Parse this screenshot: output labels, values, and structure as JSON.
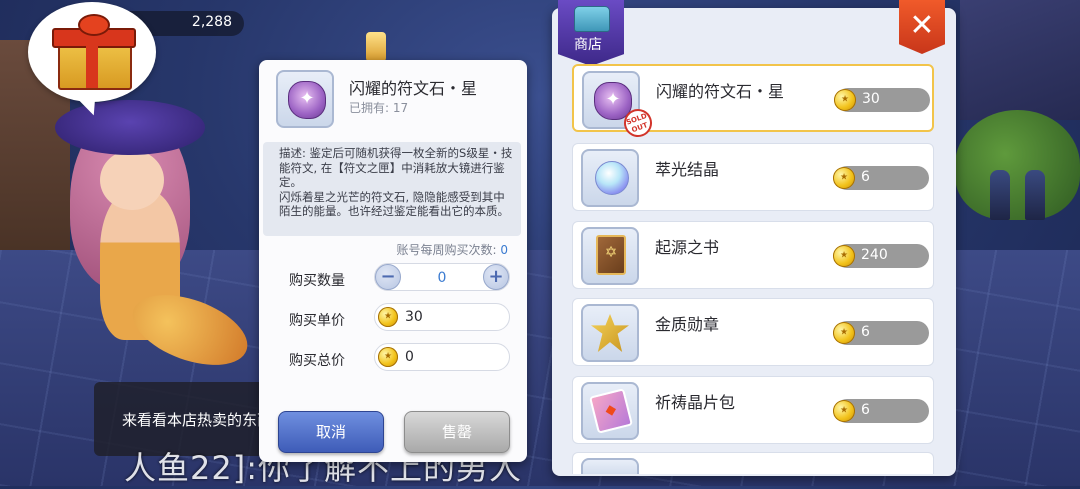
{
  "hud": {
    "coins": "2,288"
  },
  "chat": {
    "message": "来看看本店热卖的东西",
    "caption": "人鱼22]:你了解不上的男人"
  },
  "detail": {
    "item_name": "闪耀的符文石・星",
    "owned": "已拥有: 17",
    "description_1": "描述: 鉴定后可随机获得一枚全新的S级星・技能符文, 在【符文之匣】中消耗放大镜进行鉴定。",
    "description_2": "闪烁着星之光芒的符文石, 隐隐能感受到其中陌生的能量。也许经过鉴定能看出它的本质。",
    "weekly_label": "账号每周购买次数:",
    "weekly_count": "0",
    "qty_label": "购买数量",
    "qty_value": "0",
    "qty_minus": "−",
    "qty_plus": "+",
    "unit_label": "购买单价",
    "unit_price": "30",
    "total_label": "购买总价",
    "total_price": "0",
    "cancel_label": "取消",
    "sell_label": "售罄"
  },
  "shop": {
    "tab_label": "商店",
    "close_label": "✕",
    "sold_out_stamp": "SOLD OUT",
    "items": [
      {
        "name": "闪耀的符文石・星",
        "price": "30",
        "icon": "rune-stone-icon"
      },
      {
        "name": "萃光结晶",
        "price": "6",
        "icon": "crystal-icon"
      },
      {
        "name": "起源之书",
        "price": "240",
        "icon": "book-icon"
      },
      {
        "name": "金质勋章",
        "price": "6",
        "icon": "medal-icon"
      },
      {
        "name": "祈祷晶片包",
        "price": "6",
        "icon": "card-pack-icon"
      }
    ]
  },
  "colors": {
    "confirm_blue": "#3e5cb8",
    "disabled_gray": "#a9a9a9",
    "highlight_gold": "#f2c44a",
    "close_red": "#d8361c"
  }
}
